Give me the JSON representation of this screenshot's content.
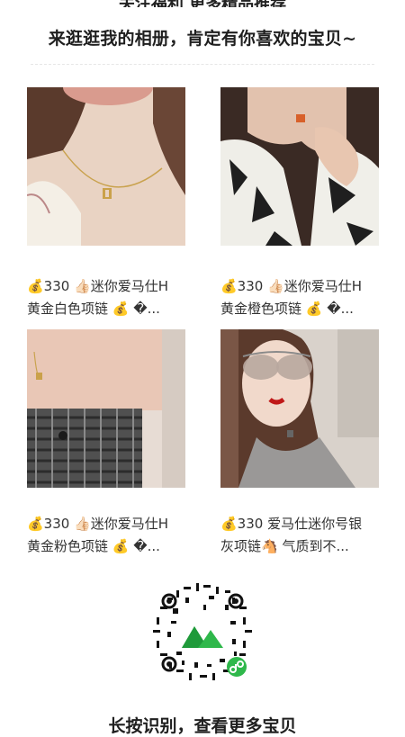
{
  "header": {
    "top_cut_text": "关注福利 更多精品推荐",
    "title": "来逛逛我的相册，肯定有你喜欢的宝贝~"
  },
  "products": [
    {
      "line1": "💰330 👍🏻迷你爱马仕H",
      "line2": "黄金白色项链 💰 �..."
    },
    {
      "line1": "💰330 👍🏻迷你爱马仕H",
      "line2": "黄金橙色项链 💰 �..."
    },
    {
      "line1": "💰330 👍🏻迷你爱马仕H",
      "line2": "黄金粉色项链 💰 �..."
    },
    {
      "line1": "💰330 爱马仕迷你号银",
      "line2": "灰项链🐴 气质到不..."
    }
  ],
  "qr": {
    "icon": "mini-program-code-icon"
  },
  "footer": {
    "text": "长按识别，查看更多宝贝"
  },
  "colors": {
    "brand_green": "#2fb84b",
    "text": "#2b2b2b"
  }
}
